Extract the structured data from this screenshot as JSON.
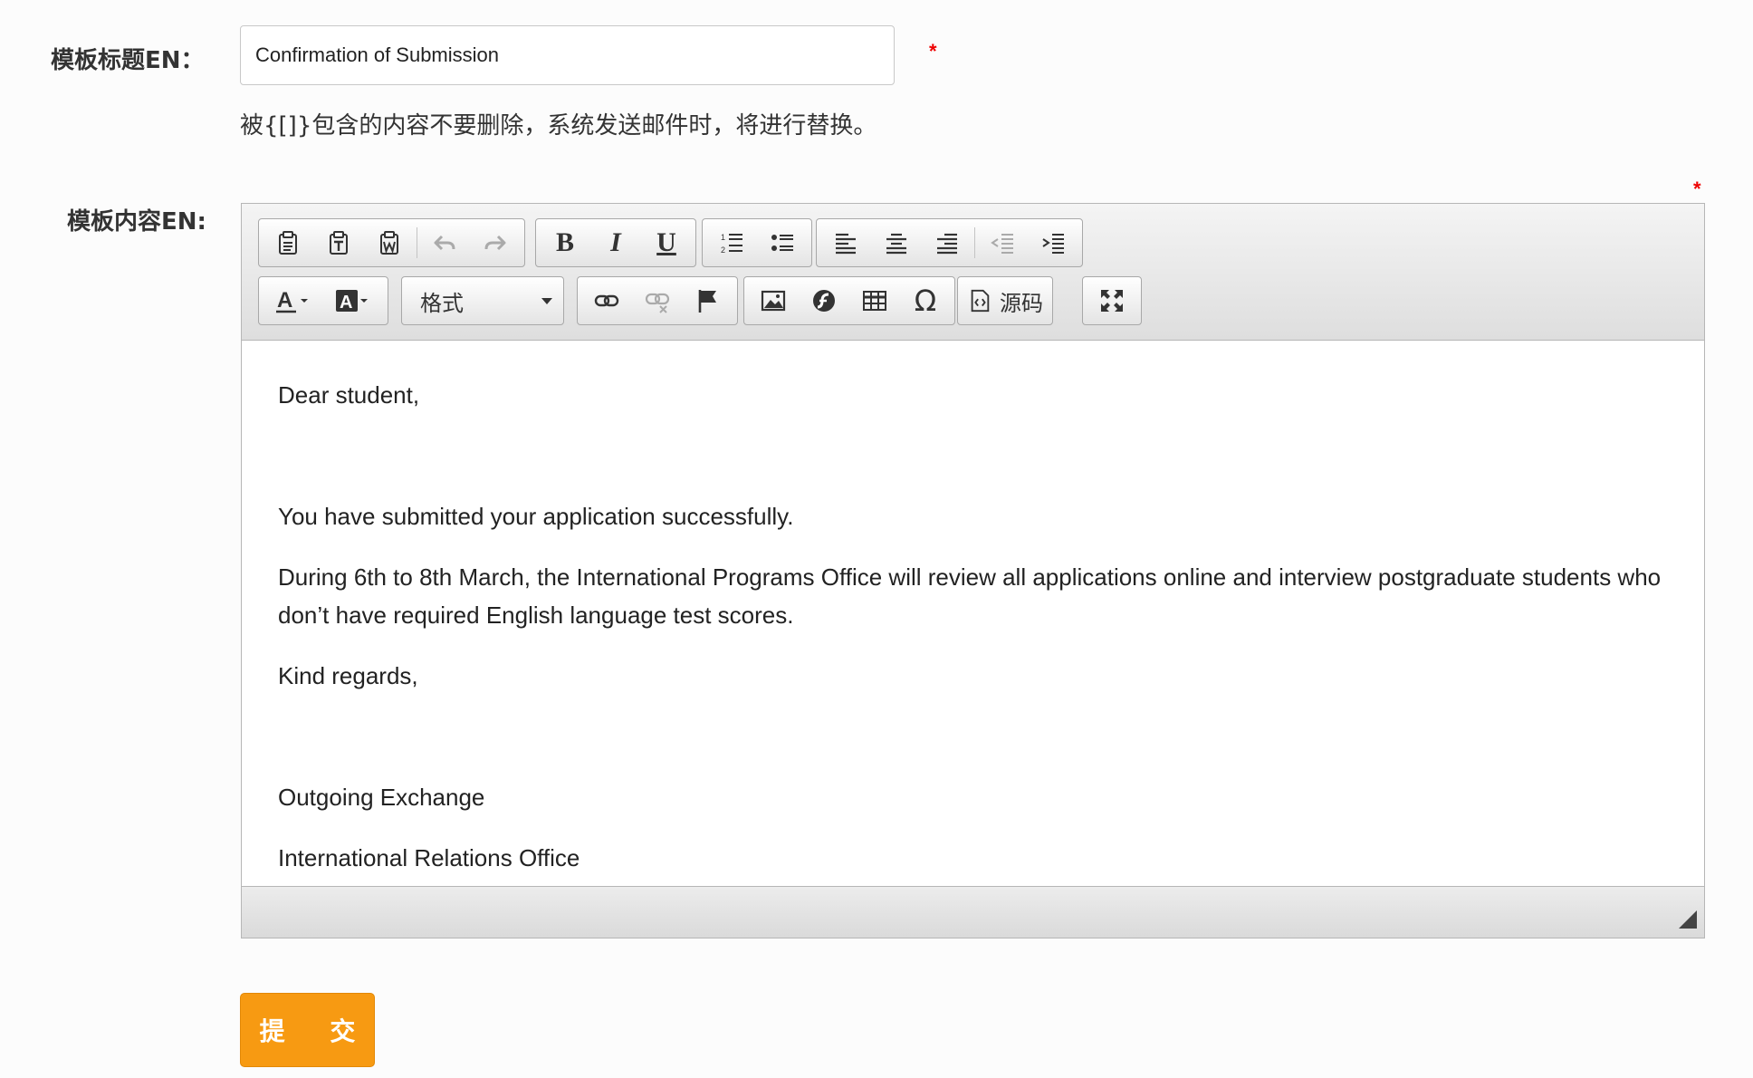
{
  "form": {
    "title_label": "模板标题EN：",
    "title_value": "Confirmation of Submission",
    "required_mark": "*",
    "hint": "被{[]}包含的内容不要删除，系统发送邮件时，将进行替换。",
    "content_label": "模板内容EN:",
    "submit_label": "提 交"
  },
  "editor": {
    "format_combo": "格式",
    "source_label": "源码",
    "icons": [
      "paste-icon",
      "paste-text-icon",
      "paste-word-icon",
      "undo-icon",
      "redo-icon",
      "bold-icon",
      "italic-icon",
      "underline-icon",
      "numbered-list-icon",
      "bullet-list-icon",
      "align-left-icon",
      "align-center-icon",
      "align-right-icon",
      "outdent-icon",
      "indent-icon",
      "text-color-icon",
      "background-color-icon",
      "link-icon",
      "unlink-icon",
      "anchor-flag-icon",
      "image-icon",
      "flash-icon",
      "table-icon",
      "special-char-icon",
      "source-icon",
      "maximize-icon"
    ],
    "paragraphs": [
      "Dear student,",
      "",
      "You have submitted your application successfully.",
      "During 6th to 8th March, the International Programs Office will review all applications online and interview postgraduate students who don’t have required English language test scores.",
      "Kind regards,",
      "",
      "Outgoing Exchange",
      "International Relations Office"
    ]
  },
  "colors": {
    "submit_bg": "#f79a12",
    "required": "#e00000"
  }
}
